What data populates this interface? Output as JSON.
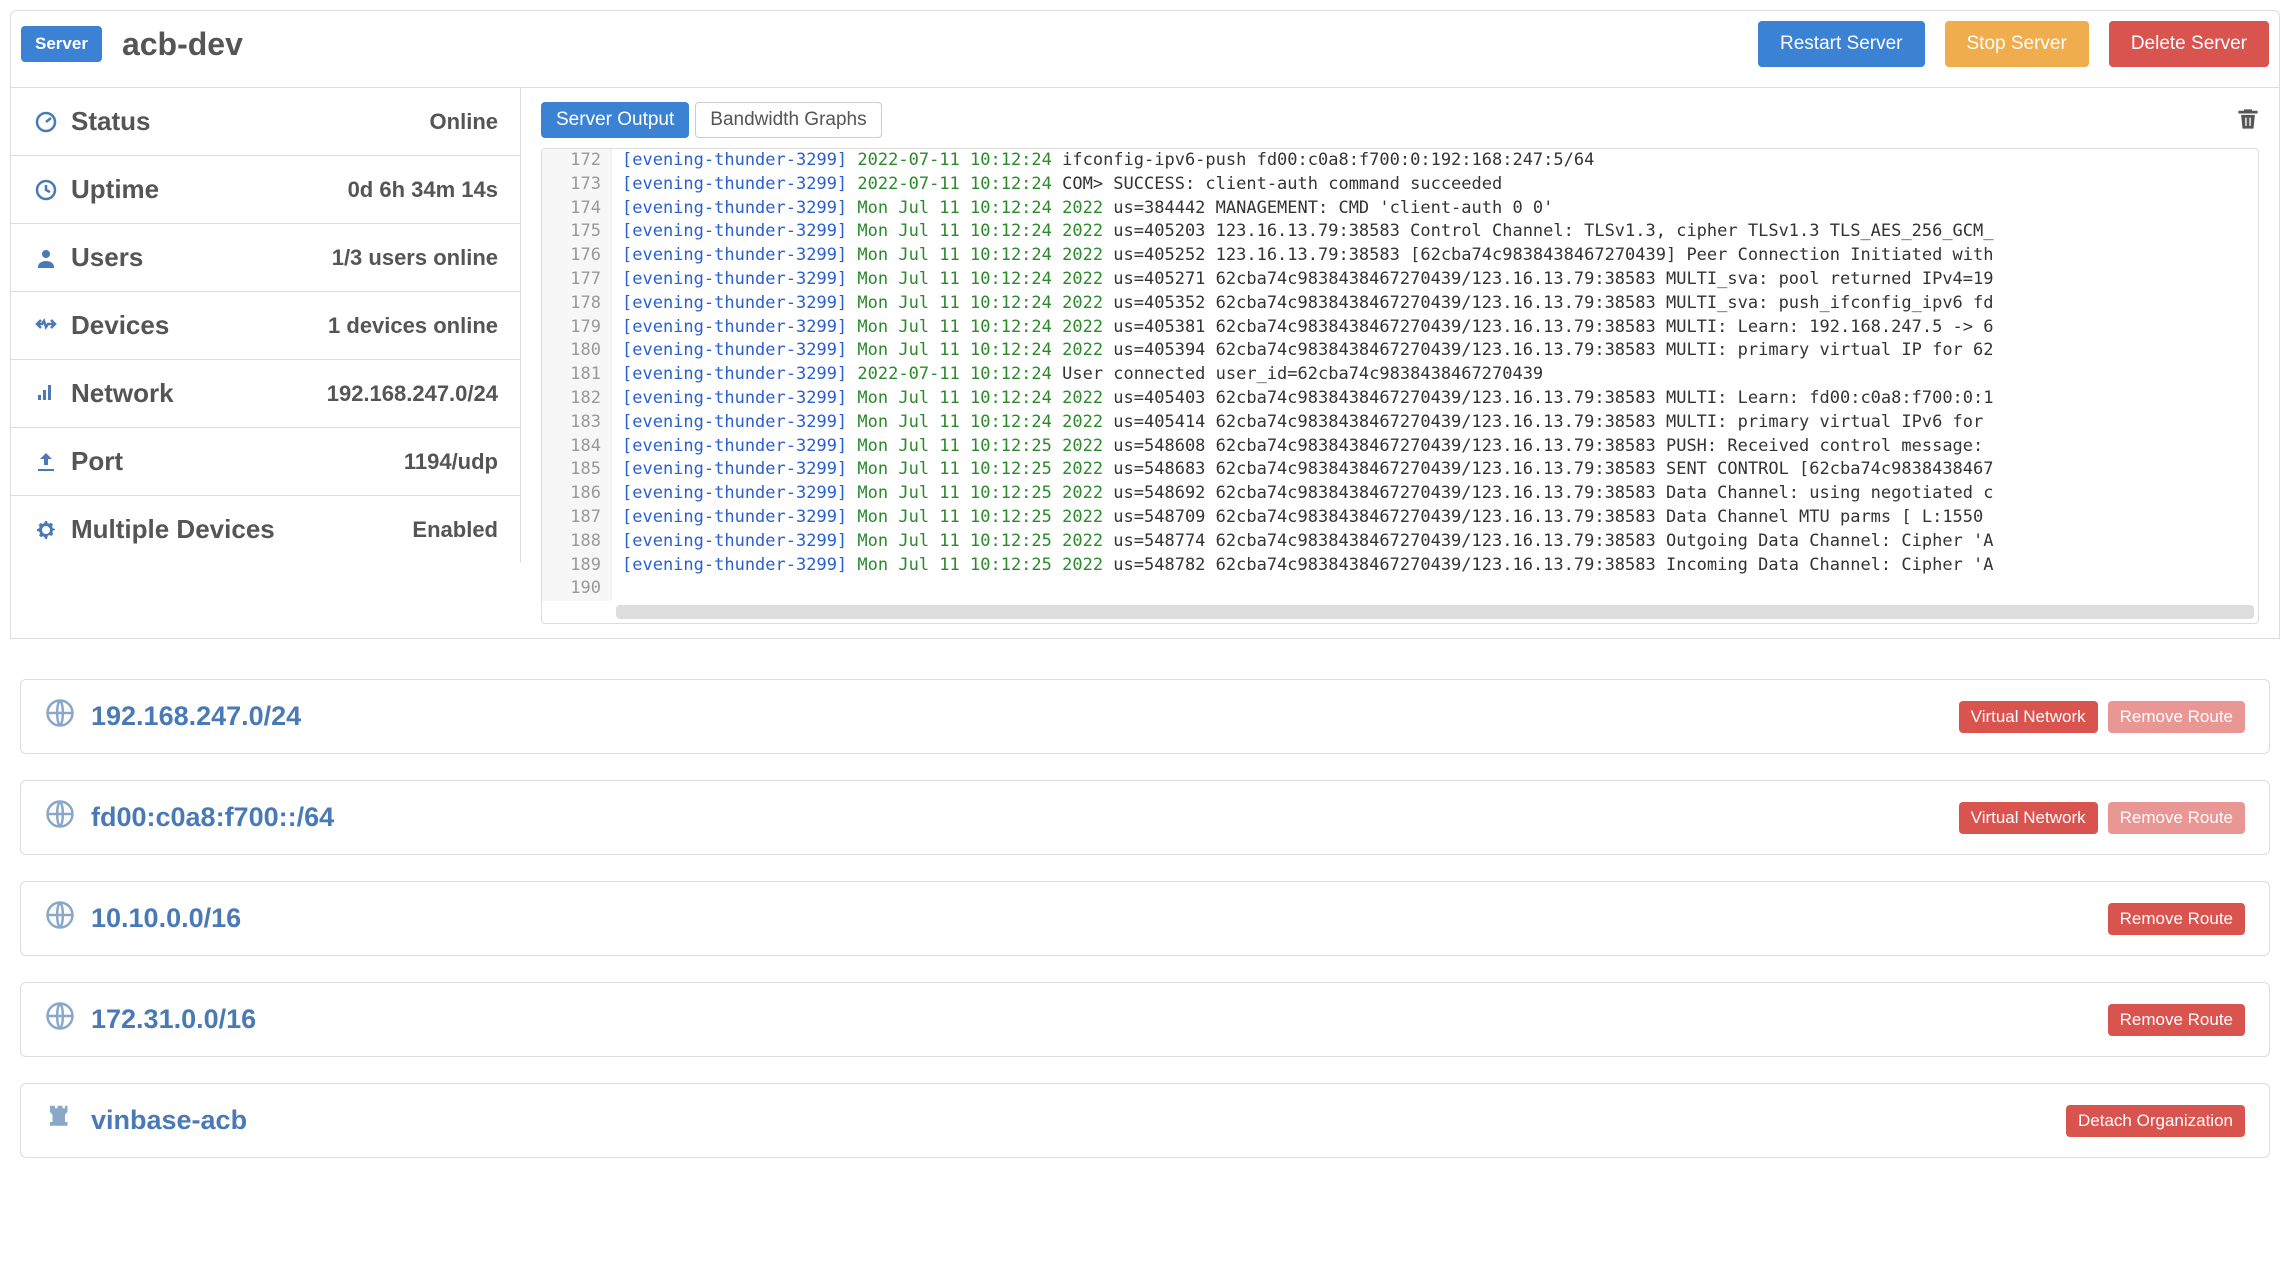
{
  "header": {
    "badge": "Server",
    "name": "acb-dev",
    "buttons": {
      "restart": "Restart Server",
      "stop": "Stop Server",
      "delete": "Delete Server"
    }
  },
  "sidebar": [
    {
      "icon": "dashboard",
      "label": "Status",
      "value": "Online"
    },
    {
      "icon": "clock",
      "label": "Uptime",
      "value": "0d 6h 34m 14s"
    },
    {
      "icon": "user",
      "label": "Users",
      "value": "1/3 users online"
    },
    {
      "icon": "devices",
      "label": "Devices",
      "value": "1 devices online"
    },
    {
      "icon": "signal",
      "label": "Network",
      "value": "192.168.247.0/24"
    },
    {
      "icon": "upload",
      "label": "Port",
      "value": "1194/udp"
    },
    {
      "icon": "gear",
      "label": "Multiple Devices",
      "value": "Enabled"
    }
  ],
  "tabs": {
    "output": "Server Output",
    "bandwidth": "Bandwidth Graphs"
  },
  "log": [
    {
      "n": "172",
      "tag": "[evening-thunder-3299]",
      "ts": "2022-07-11 10:12:24",
      "msg": "   ifconfig-ipv6-push fd00:c0a8:f700:0:192:168:247:5/64"
    },
    {
      "n": "173",
      "tag": "[evening-thunder-3299]",
      "ts": "2022-07-11 10:12:24",
      "msg": " COM> SUCCESS: client-auth command succeeded"
    },
    {
      "n": "174",
      "tag": "[evening-thunder-3299]",
      "ts": "Mon Jul 11 10:12:24 2022",
      "msg": " us=384442 MANAGEMENT: CMD 'client-auth 0 0'"
    },
    {
      "n": "175",
      "tag": "[evening-thunder-3299]",
      "ts": "Mon Jul 11 10:12:24 2022",
      "msg": " us=405203 123.16.13.79:38583 Control Channel: TLSv1.3, cipher TLSv1.3 TLS_AES_256_GCM_"
    },
    {
      "n": "176",
      "tag": "[evening-thunder-3299]",
      "ts": "Mon Jul 11 10:12:24 2022",
      "msg": " us=405252 123.16.13.79:38583 [62cba74c9838438467270439] Peer Connection Initiated with"
    },
    {
      "n": "177",
      "tag": "[evening-thunder-3299]",
      "ts": "Mon Jul 11 10:12:24 2022",
      "msg": " us=405271 62cba74c9838438467270439/123.16.13.79:38583 MULTI_sva: pool returned IPv4=19"
    },
    {
      "n": "178",
      "tag": "[evening-thunder-3299]",
      "ts": "Mon Jul 11 10:12:24 2022",
      "msg": " us=405352 62cba74c9838438467270439/123.16.13.79:38583 MULTI_sva: push_ifconfig_ipv6 fd"
    },
    {
      "n": "179",
      "tag": "[evening-thunder-3299]",
      "ts": "Mon Jul 11 10:12:24 2022",
      "msg": " us=405381 62cba74c9838438467270439/123.16.13.79:38583 MULTI: Learn: 192.168.247.5 -> 6"
    },
    {
      "n": "180",
      "tag": "[evening-thunder-3299]",
      "ts": "Mon Jul 11 10:12:24 2022",
      "msg": " us=405394 62cba74c9838438467270439/123.16.13.79:38583 MULTI: primary virtual IP for 62"
    },
    {
      "n": "181",
      "tag": "[evening-thunder-3299]",
      "ts": "2022-07-11 10:12:24",
      "msg": " User connected user_id=62cba74c9838438467270439"
    },
    {
      "n": "182",
      "tag": "[evening-thunder-3299]",
      "ts": "Mon Jul 11 10:12:24 2022",
      "msg": " us=405403 62cba74c9838438467270439/123.16.13.79:38583 MULTI: Learn: fd00:c0a8:f700:0:1"
    },
    {
      "n": "183",
      "tag": "[evening-thunder-3299]",
      "ts": "Mon Jul 11 10:12:24 2022",
      "msg": " us=405414 62cba74c9838438467270439/123.16.13.79:38583 MULTI: primary virtual IPv6 for"
    },
    {
      "n": "184",
      "tag": "[evening-thunder-3299]",
      "ts": "Mon Jul 11 10:12:25 2022",
      "msg": " us=548608 62cba74c9838438467270439/123.16.13.79:38583 PUSH: Received control message:"
    },
    {
      "n": "185",
      "tag": "[evening-thunder-3299]",
      "ts": "Mon Jul 11 10:12:25 2022",
      "msg": " us=548683 62cba74c9838438467270439/123.16.13.79:38583 SENT CONTROL [62cba74c9838438467"
    },
    {
      "n": "186",
      "tag": "[evening-thunder-3299]",
      "ts": "Mon Jul 11 10:12:25 2022",
      "msg": " us=548692 62cba74c9838438467270439/123.16.13.79:38583 Data Channel: using negotiated c"
    },
    {
      "n": "187",
      "tag": "[evening-thunder-3299]",
      "ts": "Mon Jul 11 10:12:25 2022",
      "msg": " us=548709 62cba74c9838438467270439/123.16.13.79:38583 Data Channel MTU parms [ L:1550"
    },
    {
      "n": "188",
      "tag": "[evening-thunder-3299]",
      "ts": "Mon Jul 11 10:12:25 2022",
      "msg": " us=548774 62cba74c9838438467270439/123.16.13.79:38583 Outgoing Data Channel: Cipher 'A"
    },
    {
      "n": "189",
      "tag": "[evening-thunder-3299]",
      "ts": "Mon Jul 11 10:12:25 2022",
      "msg": " us=548782 62cba74c9838438467270439/123.16.13.79:38583 Incoming Data Channel: Cipher 'A"
    },
    {
      "n": "190",
      "tag": "",
      "ts": "",
      "msg": ""
    }
  ],
  "route_labels": {
    "virtual": "Virtual Network",
    "remove": "Remove Route",
    "detach": "Detach Organization"
  },
  "routes": [
    {
      "icon": "globe",
      "label": "192.168.247.0/24",
      "virtual": true,
      "remove_disabled": true
    },
    {
      "icon": "globe",
      "label": "fd00:c0a8:f700::/64",
      "virtual": true,
      "remove_disabled": true
    },
    {
      "icon": "globe",
      "label": "10.10.0.0/16",
      "virtual": false,
      "remove_disabled": false
    },
    {
      "icon": "globe",
      "label": "172.31.0.0/16",
      "virtual": false,
      "remove_disabled": false
    }
  ],
  "org": {
    "icon": "rook",
    "label": "vinbase-acb"
  }
}
